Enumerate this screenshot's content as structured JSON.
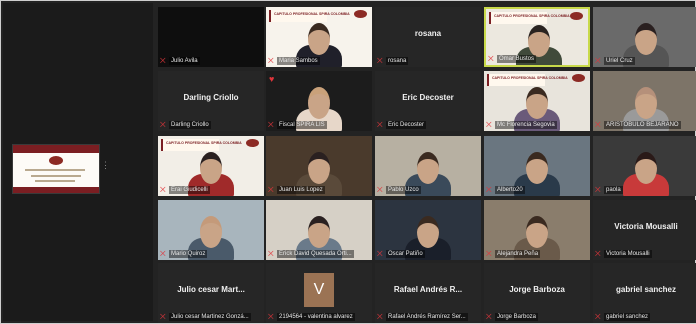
{
  "participants": [
    {
      "name": "Julio Avila",
      "display": ""
    },
    {
      "name": "Maria Sambos",
      "display": ""
    },
    {
      "name": "rosana",
      "display": "rosana"
    },
    {
      "name": "Omar Bustos",
      "display": ""
    },
    {
      "name": "Uriel Cruz",
      "display": ""
    },
    {
      "name": "Darling Criollo",
      "display": "Darling Criollo"
    },
    {
      "name": "Fiscal SPIRA LIS",
      "display": ""
    },
    {
      "name": "Eric Decoster",
      "display": "Eric Decoster"
    },
    {
      "name": "Mc Florencia Segovia",
      "display": ""
    },
    {
      "name": "ARISTOBULO BEJARANO",
      "display": ""
    },
    {
      "name": "Erai Giudicelli",
      "display": ""
    },
    {
      "name": "Juan Luis Lopez",
      "display": ""
    },
    {
      "name": "Pablo Uzco",
      "display": ""
    },
    {
      "name": "Alberto20",
      "display": ""
    },
    {
      "name": "paola",
      "display": ""
    },
    {
      "name": "Mario Quiroz",
      "display": ""
    },
    {
      "name": "Erick David Quesada Orti...",
      "display": ""
    },
    {
      "name": "Oscar Patiño",
      "display": ""
    },
    {
      "name": "Alejandra Peña",
      "display": ""
    },
    {
      "name": "Victoria Mousalli",
      "display": "Victoria Mousalli"
    },
    {
      "name": "Julio cesar Martinez Gonzá...",
      "display": "Julio cesar Mart..."
    },
    {
      "name": "2194564 - valentina alvarez",
      "display": ""
    },
    {
      "name": "Rafael Andrés Ramírez Ser...",
      "display": "Rafael Andrés R..."
    },
    {
      "name": "Jorge Barboza",
      "display": "Jorge Barboza"
    },
    {
      "name": "gabriel sanchez",
      "display": "gabriel sanchez"
    }
  ],
  "banner_text": "CAPITULO PROFESIONAL SPIRA COLOMBIA",
  "avatar_letter": "V",
  "icons": {
    "muted": "mic-off-icon",
    "reaction": "heart-icon"
  },
  "colors": {
    "muted": "#e0353b",
    "active_speaker": "#c8d94a",
    "brand": "#7b1e22"
  }
}
